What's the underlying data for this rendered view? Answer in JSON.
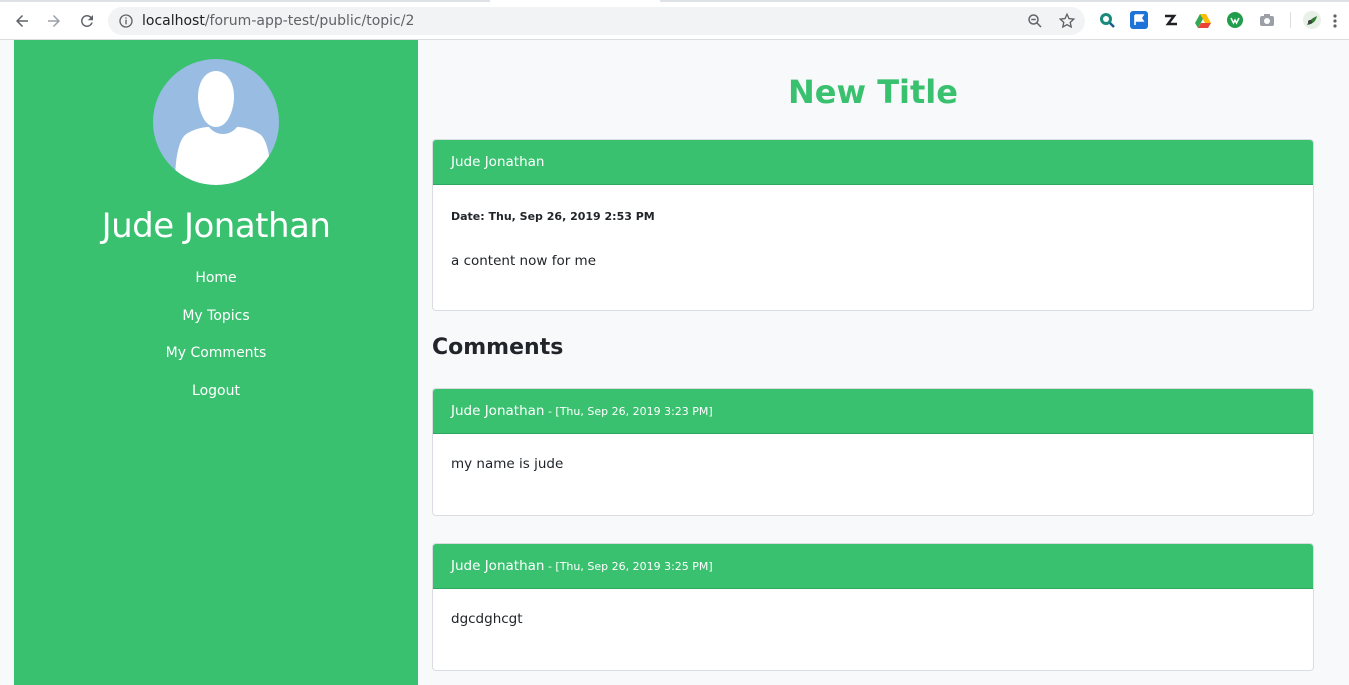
{
  "browser": {
    "url_host": "localhost",
    "url_path": "/forum-app-test/public/topic/2"
  },
  "sidebar": {
    "user_name": "Jude Jonathan",
    "menu": [
      {
        "label": "Home"
      },
      {
        "label": "My Topics"
      },
      {
        "label": "My Comments"
      },
      {
        "label": "Logout"
      }
    ]
  },
  "topic": {
    "title": "New Title",
    "author": "Jude Jonathan",
    "date": "Date: Thu, Sep 26, 2019 2:53 PM",
    "content": "a content now for me"
  },
  "comments": {
    "heading": "Comments",
    "items": [
      {
        "author": "Jude Jonathan",
        "stamp": " - [Thu, Sep 26, 2019 3:23 PM]",
        "body": "my name is jude"
      },
      {
        "author": "Jude Jonathan",
        "stamp": " - [Thu, Sep 26, 2019 3:25 PM]",
        "body": "dgcdghcgt"
      }
    ]
  },
  "colors": {
    "accent": "#3ac170",
    "avatar_bg": "#98bce2"
  }
}
